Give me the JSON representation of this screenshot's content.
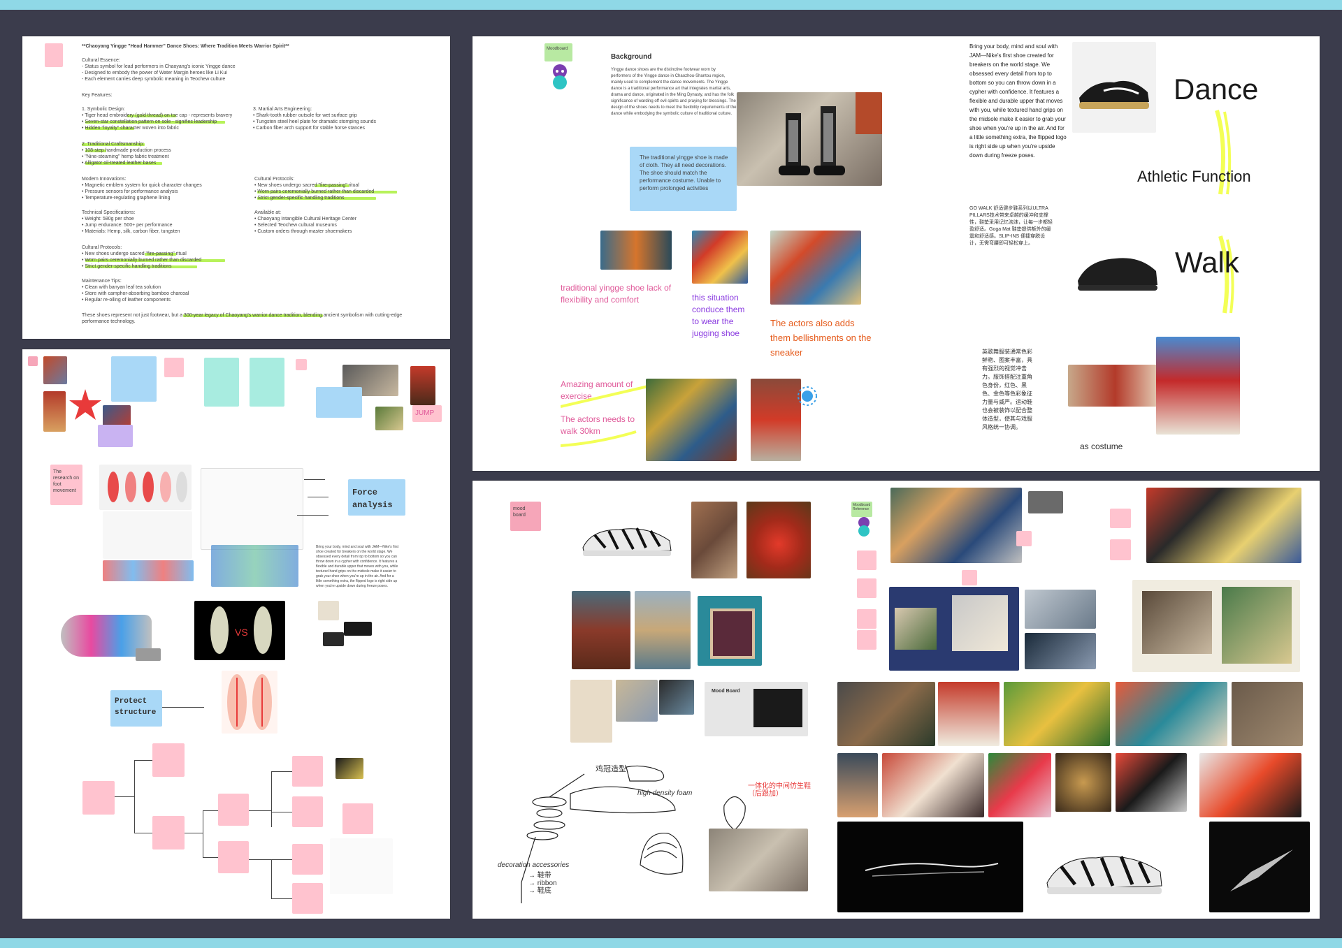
{
  "board1": {
    "title": "**Chaoyang Yingge \"Head Hammer\" Dance Shoes: Where Tradition Meets Warrior Spirit**",
    "essence_heading": "Cultural Essence:",
    "essence_items": [
      "- Status symbol for lead performers in Chaoyang's iconic Yingge dance",
      "- Designed to embody the power of Water Margin heroes like Li Kui",
      "- Each element carries deep symbolic meaning in Teochew culture"
    ],
    "features_heading": "Key Features:",
    "symbolic_heading": "1. Symbolic Design:",
    "symbolic_items": [
      "• Tiger head embroidery (gold thread) on toe cap - represents bravery",
      "• Seven-star constellation pattern on sole - signifies leadership",
      "• Hidden \"loyalty\" character woven into fabric"
    ],
    "craft_heading": "2. Traditional Craftsmanship:",
    "craft_items": [
      "• 108-step handmade production process",
      "• \"Nine-steaming\" hemp fabric treatment",
      "• Alligator oil-treated leather bases"
    ],
    "martial_heading": "3. Martial Arts Engineering:",
    "martial_items": [
      "• Shark-tooth rubber outsole for wet surface grip",
      "• Tungsten steel heel plate for dramatic stomping sounds",
      "• Carbon fiber arch support for stable horse stances"
    ],
    "modern_heading": "Modern Innovations:",
    "modern_items": [
      "• Magnetic emblem system for quick character changes",
      "• Pressure sensors for performance analysis",
      "• Temperature-regulating graphene lining"
    ],
    "protocols_heading": "Cultural Protocols:",
    "protocols_items": [
      "• New shoes undergo sacred \"fire-passing\" ritual",
      "• Worn pairs ceremonially burned rather than discarded",
      "• Strict gender-specific handling traditions"
    ],
    "tech_heading": "Technical Specifications:",
    "tech_items": [
      "• Weight: 580g per shoe",
      "• Jump endurance: 500+ per performance",
      "• Materials: Hemp, silk, carbon fiber, tungsten"
    ],
    "available_heading": "Available at:",
    "available_items": [
      "• Chaoyang Intangible Cultural Heritage Center",
      "• Selected Teochew cultural museums",
      "• Custom orders through master shoemakers"
    ],
    "protocols2_heading": "Cultural Protocols:",
    "protocols2_items": [
      "• New shoes undergo sacred \"fire-passing\" ritual",
      "• Worn pairs ceremonially burned rather than discarded",
      "• Strict gender-specific handling traditions"
    ],
    "maintenance_heading": "Maintenance Tips:",
    "maintenance_items": [
      "• Clean with banyan leaf tea solution",
      "• Store with camphor-absorbing bamboo charcoal",
      "• Regular re-oiling of leather components"
    ],
    "closing": "These shoes represent not just footwear, but a 300-year legacy of Chaoyang's warrior dance tradition, blending ancient symbolism with cutting-edge performance technology."
  },
  "board2": {
    "moodboard_tag": "Moodboard",
    "background_heading": "Background",
    "background_text": "Yingge dance shoes are the distinctive footwear worn by performers of the Yingge dance in Chaozhou-Shantou region, mainly used to complement the dance movements. The Yingge dance is a traditional performance art that integrates martial arts, drama and dance, originated in the Ming Dynasty, and has the folk significance of warding off evil spirits and praying for blessings. The design of the shoes needs to meet the flexibility requirements of the dance while embodying the symbolic culture of traditional culture.",
    "blue_note": "The traditional yingge shoe is made of cloth. They all need decorations. The shoe should match the performance costume. Unable to perform prolonged activities",
    "caption_lack": "traditional yingge shoe lack of flexibility and comfort",
    "caption_situation": "this situation conduce them to wear the jugging shoe",
    "caption_actors_adds": "The actors also adds them bellishments on the sneaker",
    "caption_exercise": "Amazing amount of exercise",
    "caption_walk": "The actors needs to walk 30km",
    "nike_text": "Bring your body, mind and soul with JAM—Nike's first shoe created for breakers on the world stage. We obsessed every detail from top to bottom so you can throw down in a cypher with confidence. It features a flexible and durable upper that moves with you, while textured hand grips on the midsole make it easier to grab your shoe when you're up in the air. And for a little something extra, the flipped logo is right side up when you're upside down during freeze poses.",
    "label_dance": "Dance",
    "label_athletic": "Athletic Function",
    "label_walk": "Walk",
    "cn_text_1": "GO WALK 舒适健步鞋系列以ULTRA PILLARS技术带来卓越的缓冲和支撑性，鞋垫采用记忆泡沫，让每一步都轻盈舒适。Goga Mat 鞋垫提供额外的缓震和舒适感。SLIP-INS 便捷穿脱设计，无需弯腰即可轻松穿上。",
    "cn_text_2": "英歌舞服装通常色彩鲜艳、图案丰富，具有强烈的视觉冲击力。服饰搭配注重角色身份，红色、黑色、金色等色彩象征力量与威严。运动鞋也会被装饰以配合整体造型，使其与戏服风格统一协调。",
    "caption_costume": "as costume"
  },
  "board3": {
    "notes_count": "sticky notes",
    "force_analysis": "Force analysis",
    "protect_structure": "Protect structure",
    "research_note": "The research on foot movement",
    "jump_label": "JUMP",
    "vs_label": "VS"
  },
  "board4": {
    "mood_board_tag": "mood board",
    "moodboard_reference": "Moodboard Reference",
    "mood_board_card": "Mood Board",
    "sketch_note_1": "鸡冠造型",
    "sketch_note_2": "high density foam",
    "sketch_note_3": "一体化的中间仿生鞋（后跟加）",
    "sketch_note_4": "decoration  accessories",
    "sketch_list": "→ 鞋带\n→ ribbon\n→ 鞋底"
  },
  "colors": {
    "canvas": "#3b3c4c",
    "frame": "#8fd8e6",
    "pink_caption": "#e05a9a",
    "purple_caption": "#8a3be0",
    "orange_caption": "#e55a1a",
    "highlight_yellow": "#f3ff56",
    "highlight_green": "#b7f25a"
  }
}
